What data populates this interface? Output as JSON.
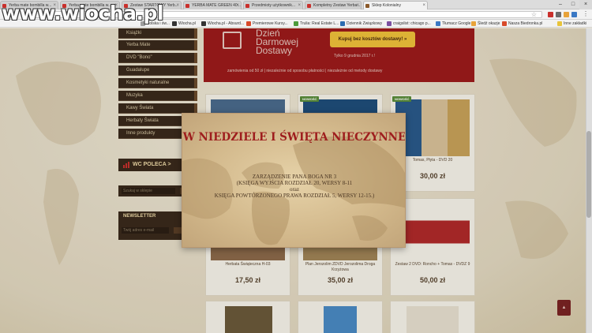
{
  "browser": {
    "tabs": [
      {
        "title": "Yerba mate bombilla w..."
      },
      {
        "title": "Yerba mate bombilla w..."
      },
      {
        "title": "Zestaw STARTOWY Yerb..."
      },
      {
        "title": "YERBA MATE GREEN 40..."
      },
      {
        "title": "Przedmioty użytkownik..."
      },
      {
        "title": "Kompletny Zestaw Yerba..."
      },
      {
        "title": "Sklep Kolonialny"
      }
    ],
    "window_controls": [
      "–",
      "□",
      "×"
    ],
    "address_url": "",
    "bookmarks": [
      {
        "label": "Polska i św..."
      },
      {
        "label": "Wiocha.pl"
      },
      {
        "label": "Wiocha.pl - Absurd..."
      },
      {
        "label": "Premierowe Kursy..."
      },
      {
        "label": "Trulia: Real Estate L..."
      },
      {
        "label": "Dziennik Związkowy"
      },
      {
        "label": "craigslist: chicago p..."
      },
      {
        "label": "Tłumacz Google"
      },
      {
        "label": "Śledź okazje"
      },
      {
        "label": "Nasza Biedronka.pl"
      },
      {
        "label": "Inne zakładki"
      }
    ]
  },
  "watermark": "www.wiocha.pl",
  "sidebar": {
    "items": [
      "Książki",
      "Yerba Mate",
      "DVD \"Bono\"",
      "Guadalupe",
      "Kosmetyki naturalne",
      "Muzyka",
      "Kawy Świata",
      "Herbaty Świata",
      "Inne produkty"
    ],
    "recommends": "WC POLECA >",
    "search_placeholder": "Szukaj w sklepie",
    "newsletter_title": "NEWSLETTER",
    "newsletter_placeholder": "Twój adres e-mail"
  },
  "banner": {
    "title_lines": [
      "Dzień",
      "Darmowej",
      "Dostawy"
    ],
    "cta": "Kupuj bez kosztów dostawy! »",
    "date": "Tylko 9 grudnia 2017 r.!",
    "note": "zamówienia od 50 zł | niezależnie od sposobu płatności | niezależnie od metody dostawy"
  },
  "products": [
    {
      "name": "",
      "price": "",
      "badge": ""
    },
    {
      "name": "",
      "price": "",
      "badge": "NOWOŚĆ"
    },
    {
      "name": "Tomas, Płyta - DVD 20",
      "price": "30,00 zł",
      "badge": "NOWOŚĆ"
    },
    {
      "name": "Herbata Świąteczna H-03",
      "price": "17,50 zł",
      "badge": ""
    },
    {
      "name": "Plan Jerozolim ZDVD Jerozolima Droga Krzyżowa",
      "price": "35,00 zł",
      "badge": ""
    },
    {
      "name": "Zestaw 2 DVD: Roncho + Tomas - DVDZ 9",
      "price": "50,00 zł",
      "badge": ""
    }
  ],
  "modal": {
    "title": "W NIEDZIELE I ŚWIĘTA NIECZYNNE",
    "lines": [
      "ZARZĄDZENIE PANA BOGA NR 3",
      "(KSIĘGA WYJŚCIA ROZDZIAŁ 20, WERSY 8-11",
      "oraz",
      "KSIĘGA POWTÓRZONEGO PRAWA ROZDZIAŁ 5, WERSY 12-15.)"
    ]
  },
  "colors": {
    "accent_red": "#9e1d1d",
    "sidebar_brown": "#3a2a1c",
    "cta_yellow": "#f0c23a",
    "parchment": "#e6d2a8"
  }
}
